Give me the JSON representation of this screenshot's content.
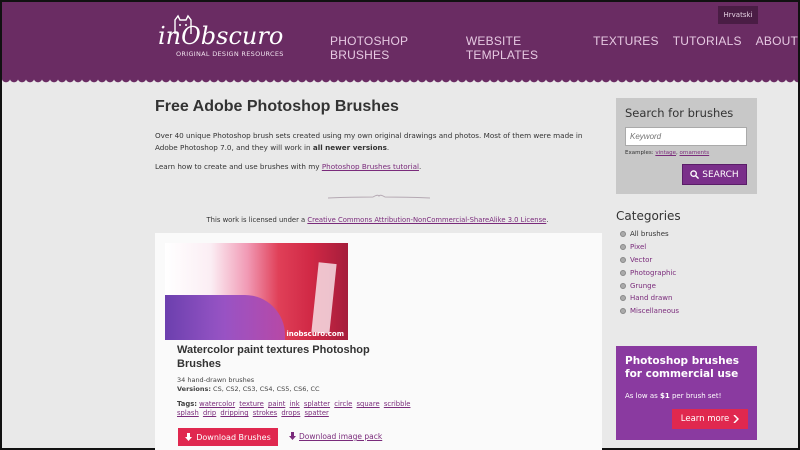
{
  "header": {
    "language": "Hrvatski",
    "logo": {
      "name": "inObscuro",
      "tagline": "ORIGINAL DESIGN RESOURCES"
    },
    "nav": [
      "PHOTOSHOP BRUSHES",
      "WEBSITE TEMPLATES",
      "TEXTURES",
      "TUTORIALS",
      "ABOUT"
    ]
  },
  "main": {
    "title": "Free Adobe Photoshop Brushes",
    "intro_part1": "Over 40 unique Photoshop brush sets created using my own original drawings and photos. Most of them were made in Adobe Photoshop 7.0, and they will work in ",
    "intro_bold": "all newer versions",
    "intro_end": ".",
    "learn_prefix": "Learn how to create and use brushes with my ",
    "learn_link": "Photoshop Brushes tutorial",
    "learn_suffix": ".",
    "license_prefix": "This work is licensed under a ",
    "license_link": "Creative Commons Attribution-NonCommercial-ShareAlike 3.0 License",
    "license_suffix": "."
  },
  "card": {
    "image_watermark": "inobscuro.com",
    "title": "Watercolor paint textures Photoshop Brushes",
    "count": "34 hand-drawn brushes",
    "versions_label": "Versions:",
    "versions": "CS, CS2, CS3, CS4, CS5, CS6, CC",
    "tags_label": "Tags:",
    "tags": [
      "watercolor",
      "texture",
      "paint",
      "ink",
      "splatter",
      "circle",
      "square",
      "scribble",
      "splash",
      "drip",
      "dripping",
      "strokes",
      "drops",
      "spatter"
    ],
    "download_label": "Download Brushes",
    "pack_label": "Download image pack"
  },
  "sidebar": {
    "search_title": "Search for brushes",
    "search_placeholder": "Keyword",
    "examples_label": "Examples:",
    "example1": "vintage",
    "example2": "ornaments",
    "search_button": "SEARCH",
    "categories_title": "Categories",
    "categories": [
      "All brushes",
      "Pixel",
      "Vector",
      "Photographic",
      "Grunge",
      "Hand drawn",
      "Miscellaneous"
    ],
    "promo_title": "Photoshop brushes for commercial use",
    "promo_sub_prefix": "As low as ",
    "promo_sub_bold": "$1",
    "promo_sub_suffix": " per brush set!",
    "promo_button": "Learn more"
  },
  "colors": {
    "header": "#6a2c63",
    "accent": "#e0284f",
    "link": "#7a2b7b",
    "promo": "#8a3aa0"
  }
}
